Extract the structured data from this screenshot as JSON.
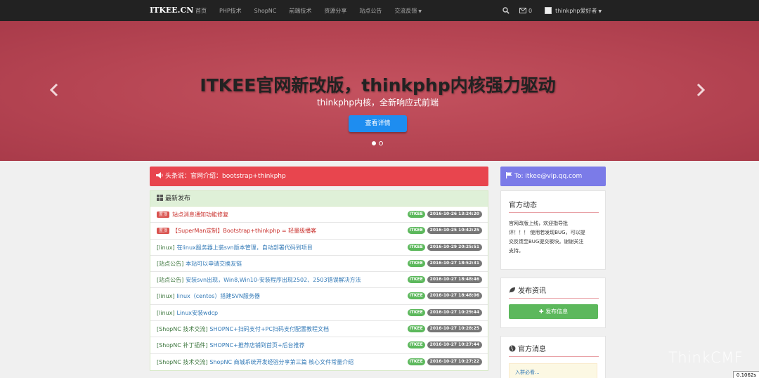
{
  "navbar": {
    "brand": "ITKEE.CN",
    "links": [
      "首页",
      "PHP技术",
      "ShopNC",
      "前端技术",
      "资源分享",
      "站点公告",
      "交流反馈"
    ],
    "mail_count": "0",
    "user_name": "thinkphp爱好者"
  },
  "carousel": {
    "title": "ITKEE官网新改版，thinkphp内核强力驱动",
    "subtitle": "thinkphp内核，全新响应式前端",
    "button": "查看详情"
  },
  "alert": {
    "text": "头条说：官网介绍：bootstrap+thinkphp"
  },
  "news": {
    "heading": "最新发布",
    "rows": [
      {
        "tag": "置顶",
        "category": "",
        "title": "站点消息通知功能修复",
        "style": "red",
        "author": "ITKEE",
        "time": "2016-10-26 13:24:20"
      },
      {
        "tag": "置顶",
        "category": "",
        "title": "【SuperMan定制】Bootstrap+thinkphp = 轻量级播客",
        "style": "red",
        "author": "ITKEE",
        "time": "2016-10-25 10:42:25"
      },
      {
        "tag": "",
        "category": "[linux]",
        "title": "在linux服务器上装svn版本管理，自动部署代码到项目",
        "style": "blue",
        "author": "ITKEE",
        "time": "2016-10-29 20:25:51"
      },
      {
        "tag": "",
        "category": "[站点公告]",
        "title": "本站可以申请交换友链",
        "style": "blue",
        "author": "ITKEE",
        "time": "2016-10-27 18:52:31"
      },
      {
        "tag": "",
        "category": "[站点公告]",
        "title": "安装svn出现，Win8,Win10-安装程序出现2502、2503错误解决方法",
        "style": "blue",
        "author": "ITKEE",
        "time": "2016-10-27 18:48:46"
      },
      {
        "tag": "",
        "category": "[linux]",
        "title": "linux（centos）搭建SVN服务器",
        "style": "blue",
        "author": "ITKEE",
        "time": "2016-10-27 18:48:06"
      },
      {
        "tag": "",
        "category": "[linux]",
        "title": "Linux安装wdcp",
        "style": "blue",
        "author": "ITKEE",
        "time": "2016-10-27 10:29:44"
      },
      {
        "tag": "",
        "category": "[ShopNC 技术交流]",
        "title": "SHOPNC+扫码支付+PC扫码支付配置教程文档",
        "style": "blue",
        "author": "ITKEE",
        "time": "2016-10-27 10:28:25"
      },
      {
        "tag": "",
        "category": "[ShopNC 补丁插件]",
        "title": "SHOPNC+推荐店铺到首页+后台推荐",
        "style": "blue",
        "author": "ITKEE",
        "time": "2016-10-27 10:27:44"
      },
      {
        "tag": "",
        "category": "[ShopNC 技术交流]",
        "title": "ShopNC 商城系统开发经验分享第三篇 核心文件常量介绍",
        "style": "blue",
        "author": "ITKEE",
        "time": "2016-10-27 10:27:22"
      }
    ]
  },
  "sidebar": {
    "contact": "To: itkee@vip.qq.com",
    "dynamic_title": "官方动态",
    "dynamic_lines": [
      "官网改版上线，欢迎指导批",
      "评！！！ 使用若发现BUG，可以提",
      "交反馈至BUG提交板块。谢谢关注",
      "支持。"
    ],
    "publish_title": "发布资讯",
    "publish_button": "发布信息",
    "message_title": "官方消息",
    "message_placeholder": "入群必看..."
  },
  "watermark": "ThinkCMF",
  "timer": "0.1062s"
}
